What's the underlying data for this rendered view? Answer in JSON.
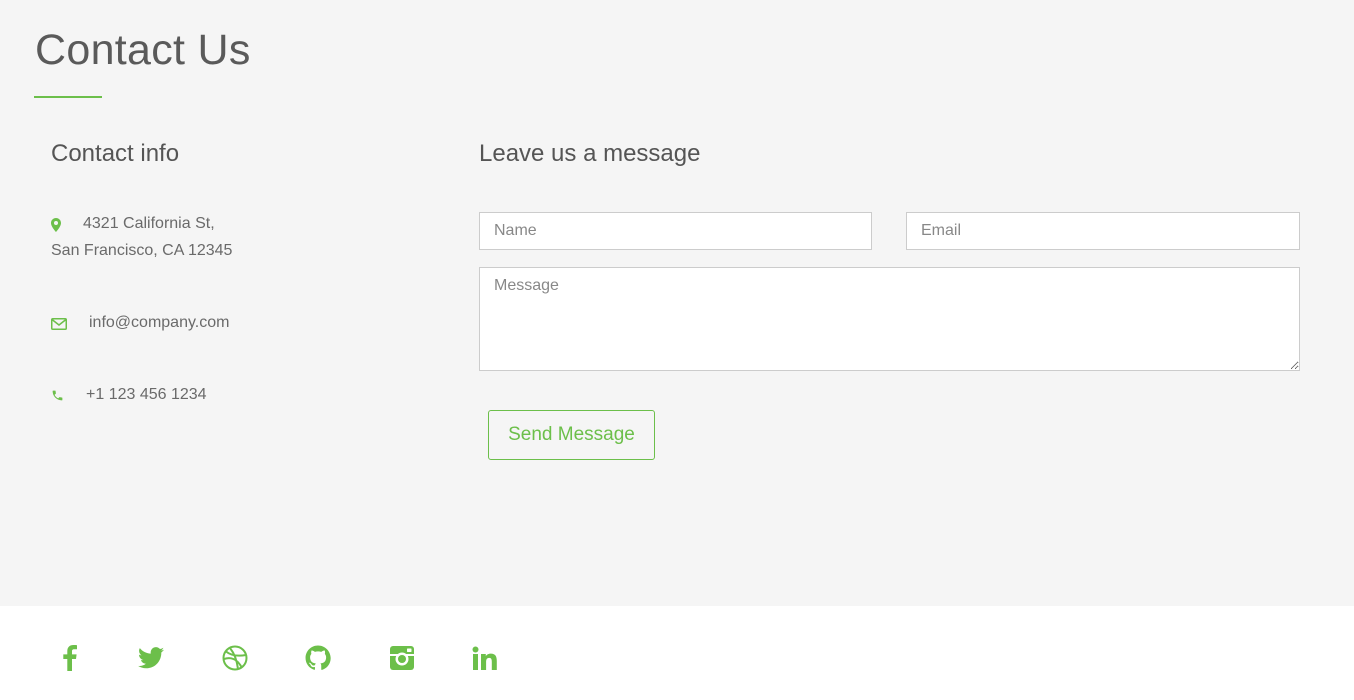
{
  "page": {
    "title": "Contact Us"
  },
  "contact": {
    "heading": "Contact info",
    "address_line1": "4321 California St,",
    "address_line2": "San Francisco, CA 12345",
    "email": "info@company.com",
    "phone": "+1 123 456 1234"
  },
  "form": {
    "heading": "Leave us a message",
    "name_placeholder": "Name",
    "email_placeholder": "Email",
    "message_placeholder": "Message",
    "send_label": "Send Message"
  },
  "colors": {
    "accent": "#6cbf4a",
    "background": "#f5f5f5",
    "footer": "#ffffff"
  },
  "footer": {
    "social_icons": [
      "facebook-icon",
      "twitter-icon",
      "dribbble-icon",
      "github-icon",
      "instagram-icon",
      "linkedin-icon"
    ]
  }
}
